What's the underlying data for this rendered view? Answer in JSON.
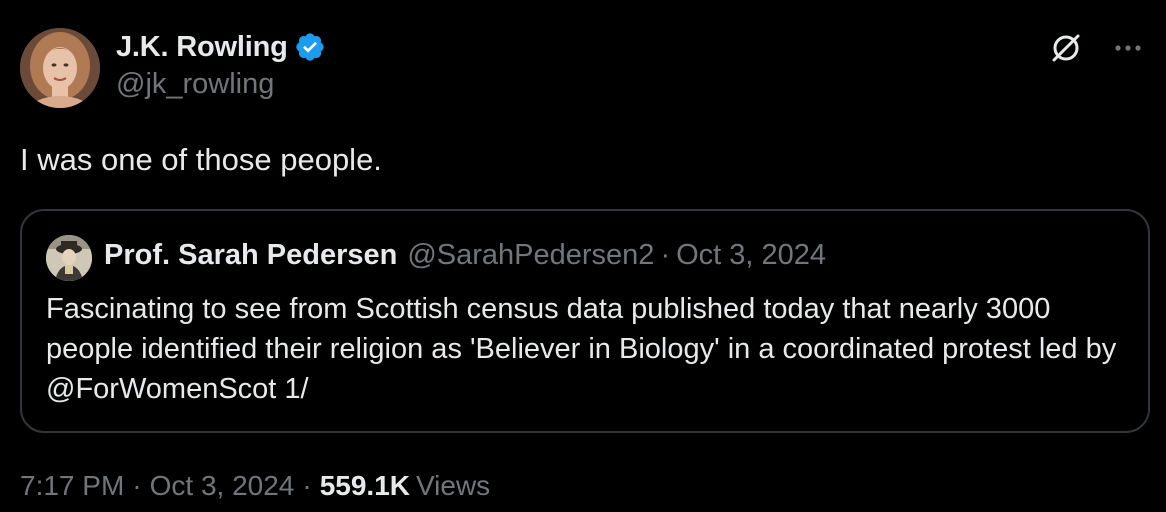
{
  "author": {
    "display_name": "J.K. Rowling",
    "handle": "@jk_rowling",
    "verified": true
  },
  "icons": {
    "verified": "verified-badge-icon",
    "grok": "grok-icon",
    "more": "more-options-icon"
  },
  "tweet": {
    "text": "I was one of those people."
  },
  "quoted_tweet": {
    "display_name": "Prof. Sarah Pedersen",
    "handle": "@SarahPedersen2",
    "separator": "·",
    "date": "Oct 3, 2024",
    "text": "Fascinating to see from Scottish census data published today that nearly 3000 people identified their religion as 'Believer in Biology' in a coordinated protest led by @ForWomenScot 1/"
  },
  "meta": {
    "time": "7:17 PM",
    "separator": "·",
    "date": "Oct 3, 2024",
    "views_count": "559.1K",
    "views_label": "Views"
  },
  "colors": {
    "background": "#000000",
    "primary_text": "#e7e9ea",
    "secondary_text": "#71767b",
    "border": "#333639",
    "verified_blue": "#1d9bf0"
  }
}
